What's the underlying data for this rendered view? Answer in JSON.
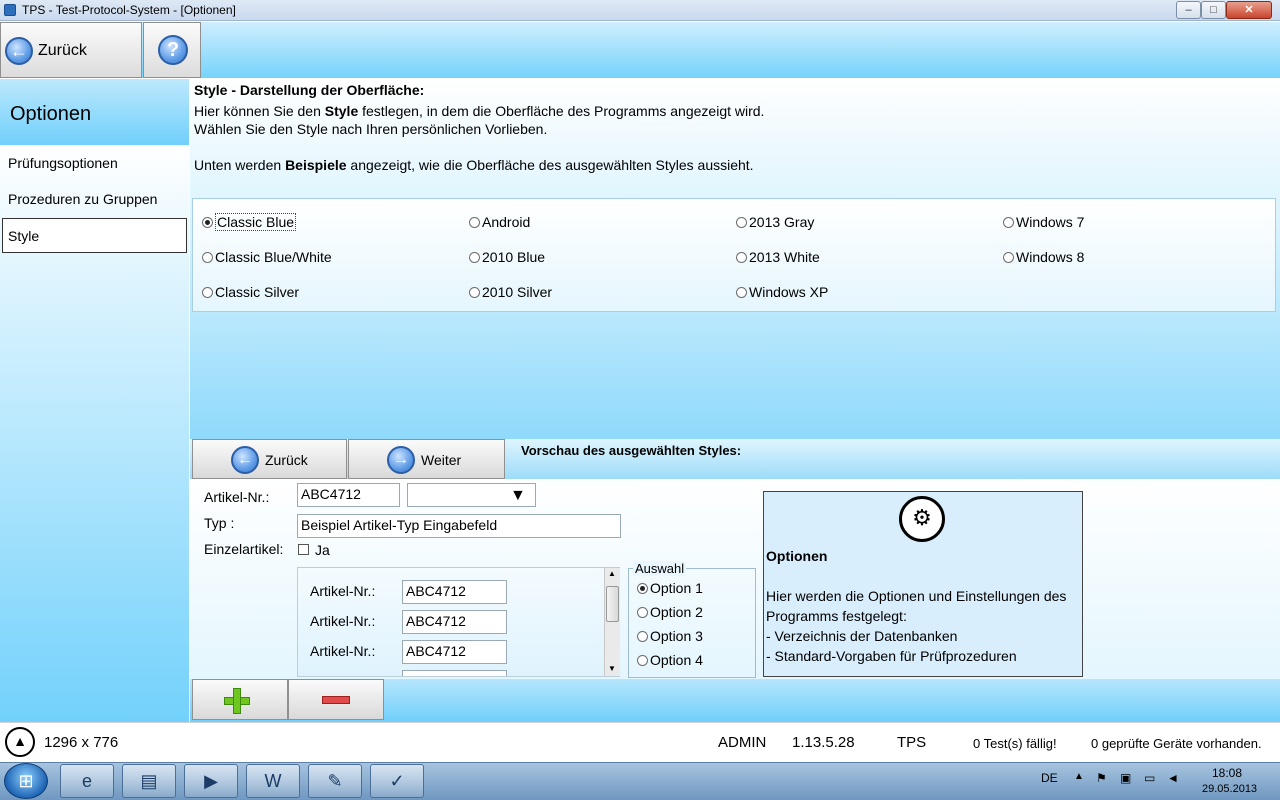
{
  "window": {
    "title": "TPS - Test-Protocol-System - [Optionen]",
    "min": "–",
    "max": "□",
    "close": "✕"
  },
  "toolbar": {
    "back_label": "Zurück",
    "back_icon": "←",
    "help_icon": "?"
  },
  "sidebar": {
    "title": "Optionen",
    "items": [
      {
        "label": "Prüfungsoptionen"
      },
      {
        "label": "Prozeduren zu Gruppen"
      },
      {
        "label": "Style"
      }
    ]
  },
  "content": {
    "heading": "Style - Darstellung der Oberfläche:",
    "line1_pre": "Hier können Sie den ",
    "line1_bold": "Style",
    "line1_post": " festlegen, in dem die Oberfläche des Programms angezeigt wird.",
    "line2": "Wählen Sie den Style nach Ihren persönlichen Vorlieben.",
    "line3_pre": "Unten werden ",
    "line3_bold": "Beispiele",
    "line3_post": " angezeigt, wie die Oberfläche des ausgewählten Styles aussieht.",
    "styles": [
      "Classic Blue",
      "Android",
      "2013 Gray",
      "Windows 7",
      "Classic Blue/White",
      "2010 Blue",
      "2013 White",
      "Windows 8",
      "Classic Silver",
      "2010 Silver",
      "Windows XP"
    ],
    "selected_style": "Classic Blue"
  },
  "preview": {
    "back_label": "Zurück",
    "next_label": "Weiter",
    "back_icon": "←",
    "next_icon": "→",
    "title": "Vorschau des ausgewählten Styles:",
    "artikel_label": "Artikel-Nr.:",
    "artikel_value": "ABC4712",
    "combo_arrow": "▼",
    "typ_label": "Typ :",
    "typ_value": "Beispiel Artikel-Typ Eingabefeld",
    "einzel_label": "Einzelartikel:",
    "einzel_check_label": "Ja",
    "list": [
      {
        "label": "Artikel-Nr.:",
        "value": "ABC4712"
      },
      {
        "label": "Artikel-Nr.:",
        "value": "ABC4712"
      },
      {
        "label": "Artikel-Nr.:",
        "value": "ABC4712"
      }
    ],
    "auswahl_title": "Auswahl",
    "options": [
      "Option 1",
      "Option 2",
      "Option 3",
      "Option 4"
    ],
    "info_title": "Optionen",
    "info_text1": "Hier werden die Optionen und Einstellungen des",
    "info_text2": "Programms festgelegt:",
    "info_text3": "- Verzeichnis der Datenbanken",
    "info_text4": "- Standard-Vorgaben für Prüfprozeduren",
    "gear_icon": "⚙"
  },
  "status": {
    "resolution": "1296 x 776",
    "user": "ADMIN",
    "version": "1.13.5.28",
    "app": "TPS",
    "tests_due": "0 Test(s) fällig!",
    "devices": "0 geprüfte Geräte vorhanden."
  },
  "taskbar": {
    "lang": "DE",
    "time": "18:08",
    "date": "29.05.2013",
    "apps": [
      "ie-icon",
      "explorer-icon",
      "media-player-icon",
      "word-icon",
      "paint-icon",
      "tps-icon"
    ]
  }
}
